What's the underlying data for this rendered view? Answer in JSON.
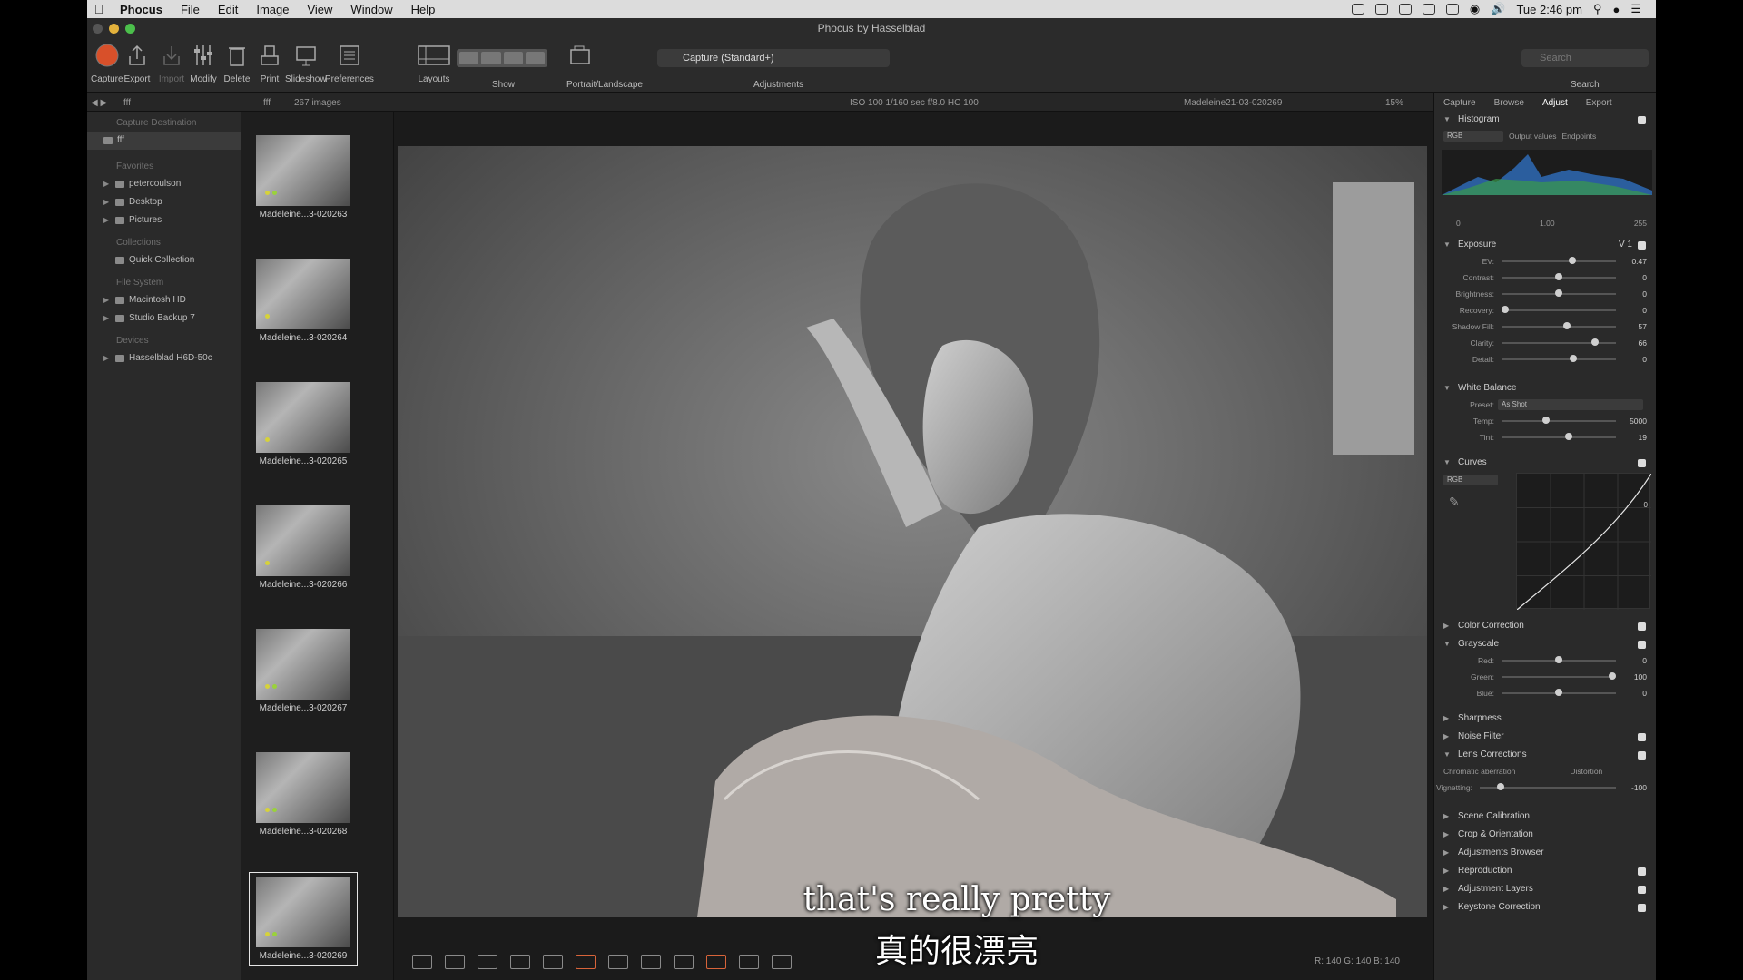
{
  "menubar": {
    "app": "Phocus",
    "items": [
      "File",
      "Edit",
      "Image",
      "View",
      "Window",
      "Help"
    ],
    "clock": "Tue 2:46 pm"
  },
  "window": {
    "title": "Phocus by Hasselblad"
  },
  "toolbar": {
    "buttons": [
      "Capture",
      "Export",
      "Import",
      "Modify",
      "Delete",
      "Print",
      "Slideshow",
      "Preferences",
      "Layouts"
    ],
    "show_label": "Show",
    "orientation_label": "Portrait/Landscape",
    "capture_preset": "Capture (Standard+)",
    "adjustments_label": "Adjustments",
    "search_placeholder": "Search",
    "search_label": "Search"
  },
  "infostrip": {
    "folder": "fff",
    "folder2": "fff",
    "count": "267 images",
    "exif": "ISO 100  1/160 sec  f/8.0  HC 100",
    "filename": "Madeleine21-03-020269",
    "zoom": "15%"
  },
  "sidebar": {
    "capture_destination": "Capture Destination",
    "capture_folder": "fff",
    "favorites_head": "Favorites",
    "favorites": [
      "petercoulson",
      "Desktop",
      "Pictures"
    ],
    "collections_head": "Collections",
    "collections": [
      "Quick Collection"
    ],
    "filesystem_head": "File System",
    "filesystem": [
      "Macintosh HD",
      "Studio Backup 7"
    ],
    "devices_head": "Devices",
    "devices": [
      "Hasselblad H6D-50c"
    ]
  },
  "filmstrip": {
    "items": [
      {
        "caption": "Madeleine...3-020263"
      },
      {
        "caption": "Madeleine...3-020264"
      },
      {
        "caption": "Madeleine...3-020265"
      },
      {
        "caption": "Madeleine...3-020266"
      },
      {
        "caption": "Madeleine...3-020267"
      },
      {
        "caption": "Madeleine...3-020268"
      },
      {
        "caption": "Madeleine...3-020269"
      }
    ]
  },
  "viewer": {
    "subtitle_en": "that's really pretty",
    "subtitle_zh": "真的很漂亮",
    "rgb_readout": "R: 140  G: 140  B: 140"
  },
  "rpanel": {
    "tabs": [
      "Capture",
      "Browse",
      "Adjust",
      "Export"
    ],
    "active_tab": "Adjust",
    "histogram": {
      "title": "Histogram",
      "channel": "RGB",
      "output_values": "Output values",
      "endpoints": "Endpoints",
      "min": "0",
      "max": "255",
      "mid": "1.00",
      "lo": "0",
      "hi": "255"
    },
    "exposure": {
      "title": "Exposure",
      "version": "V 1",
      "rows": [
        {
          "label": "EV:",
          "value": "0.47",
          "pos": 0.62
        },
        {
          "label": "Contrast:",
          "value": "0",
          "pos": 0.5
        },
        {
          "label": "Brightness:",
          "value": "0",
          "pos": 0.5
        },
        {
          "label": "Recovery:",
          "value": "0",
          "pos": 0.03
        },
        {
          "label": "Shadow Fill:",
          "value": "57",
          "pos": 0.57
        },
        {
          "label": "Clarity:",
          "value": "66",
          "pos": 0.82
        },
        {
          "label": "Detail:",
          "value": "0",
          "pos": 0.63
        }
      ]
    },
    "white_balance": {
      "title": "White Balance",
      "preset_label": "Preset:",
      "preset": "As Shot",
      "rows": [
        {
          "label": "Temp:",
          "value": "5000",
          "pos": 0.39
        },
        {
          "label": "Tint:",
          "value": "19",
          "pos": 0.59
        }
      ]
    },
    "curves": {
      "title": "Curves",
      "channel": "RGB",
      "point": "0"
    },
    "color_correction": "Color Correction",
    "grayscale": {
      "title": "Grayscale",
      "rows": [
        {
          "label": "Red:",
          "value": "0",
          "pos": 0.5
        },
        {
          "label": "Green:",
          "value": "100",
          "pos": 0.97
        },
        {
          "label": "Blue:",
          "value": "0",
          "pos": 0.5
        }
      ]
    },
    "sharpness": "Sharpness",
    "noise_filter": "Noise Filter",
    "lens_corrections": {
      "title": "Lens Corrections",
      "chromatic": "Chromatic aberration",
      "distortion": "Distortion",
      "vignetting": "Vignetting:",
      "vignetting_value": "-100",
      "vignetting_pos": 0.15
    },
    "scene_calibration": "Scene Calibration",
    "crop_orientation": "Crop & Orientation",
    "adjustments_browser": "Adjustments Browser",
    "reproduction": "Reproduction",
    "adjustment_layers": "Adjustment Layers",
    "keystone": "Keystone Correction"
  },
  "colors": {
    "capture_red": "#d8502a",
    "accent_orange": "#d8643a",
    "dot_yellow": "#d6d23a",
    "dot_green": "#9ad23a"
  }
}
